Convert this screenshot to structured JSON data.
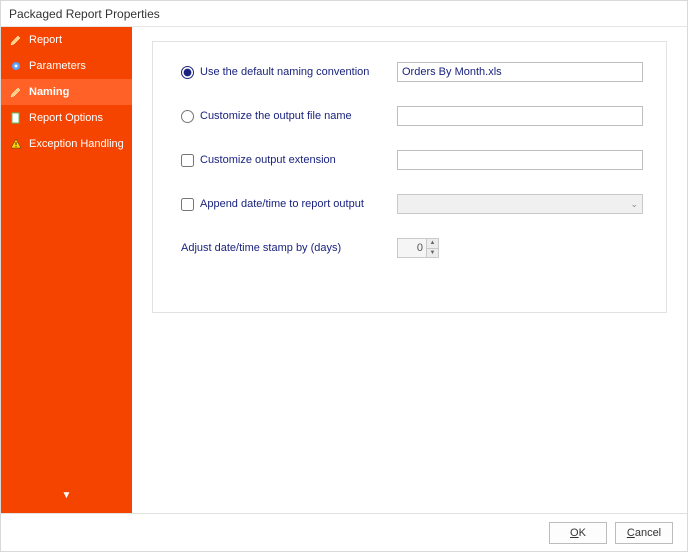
{
  "window": {
    "title": "Packaged Report Properties"
  },
  "sidebar": {
    "items": [
      {
        "label": "Report",
        "icon": "pencil"
      },
      {
        "label": "Parameters",
        "icon": "gear"
      },
      {
        "label": "Naming",
        "icon": "pencil"
      },
      {
        "label": "Report Options",
        "icon": "page"
      },
      {
        "label": "Exception Handling",
        "icon": "warning"
      }
    ],
    "active_index": 2
  },
  "main": {
    "default_naming": {
      "label": "Use the default naming convention",
      "value": "Orders By Month.xls",
      "checked": true
    },
    "customize_filename": {
      "label": "Customize the output file name",
      "value": "",
      "checked": false
    },
    "customize_extension": {
      "label": "Customize output extension",
      "value": "",
      "checked": false
    },
    "append_datetime": {
      "label": "Append date/time to report output",
      "value": "",
      "checked": false
    },
    "adjust_stamp": {
      "label": "Adjust date/time stamp by (days)",
      "value": "0"
    }
  },
  "footer": {
    "ok": "OK",
    "cancel": "Cancel"
  }
}
